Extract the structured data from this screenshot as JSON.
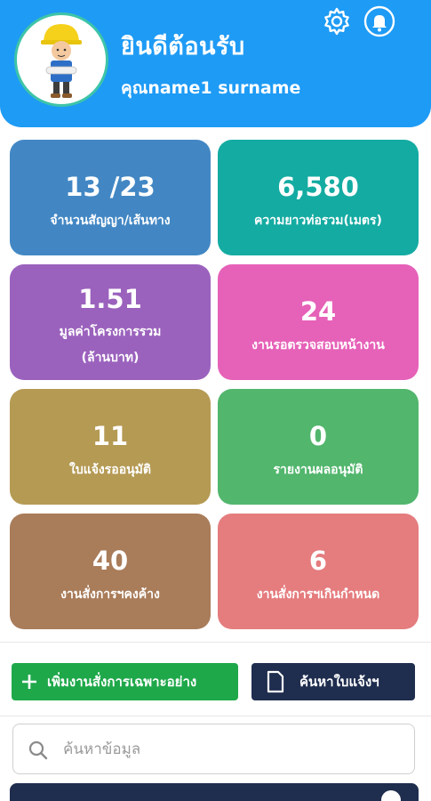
{
  "header": {
    "welcome": "ยินดีต้อนรับ",
    "username": "คุณname1 surname",
    "bg_color": "#1e9bf5",
    "icons": [
      "gear-icon",
      "bell-icon"
    ]
  },
  "stats": [
    {
      "value": "13 /23",
      "label": "จำนวนสัญญา/เส้นทาง",
      "color": "#4287c4"
    },
    {
      "value": "6,580",
      "label": "ความยาวท่อรวม(เมตร)",
      "color": "#14aba2"
    },
    {
      "value": "1.51",
      "label": "มูลค่าโครงการรวม\n(ล้านบาท)",
      "color": "#9b62bd"
    },
    {
      "value": "24",
      "label": "งานรอตรวจสอบหน้างาน",
      "color": "#e661b8"
    },
    {
      "value": "11",
      "label": "ใบแจ้งรออนุมัติ",
      "color": "#b59a54"
    },
    {
      "value": "0",
      "label": "รายงานผลอนุมัติ",
      "color": "#52b66d"
    },
    {
      "value": "40",
      "label": "งานสั่งการฯคงค้าง",
      "color": "#a97c5a"
    },
    {
      "value": "6",
      "label": "งานสั่งการฯเกินกำหนด",
      "color": "#e57c7e"
    }
  ],
  "actions": {
    "add_label": "เพิ่มงานสั่งการเฉพาะอย่าง",
    "add_color": "#1fa84a",
    "search_label": "ค้นหาใบแจ้งฯ",
    "search_color": "#1f2d4e"
  },
  "search": {
    "placeholder": "ค้นหาข้อมูล"
  }
}
